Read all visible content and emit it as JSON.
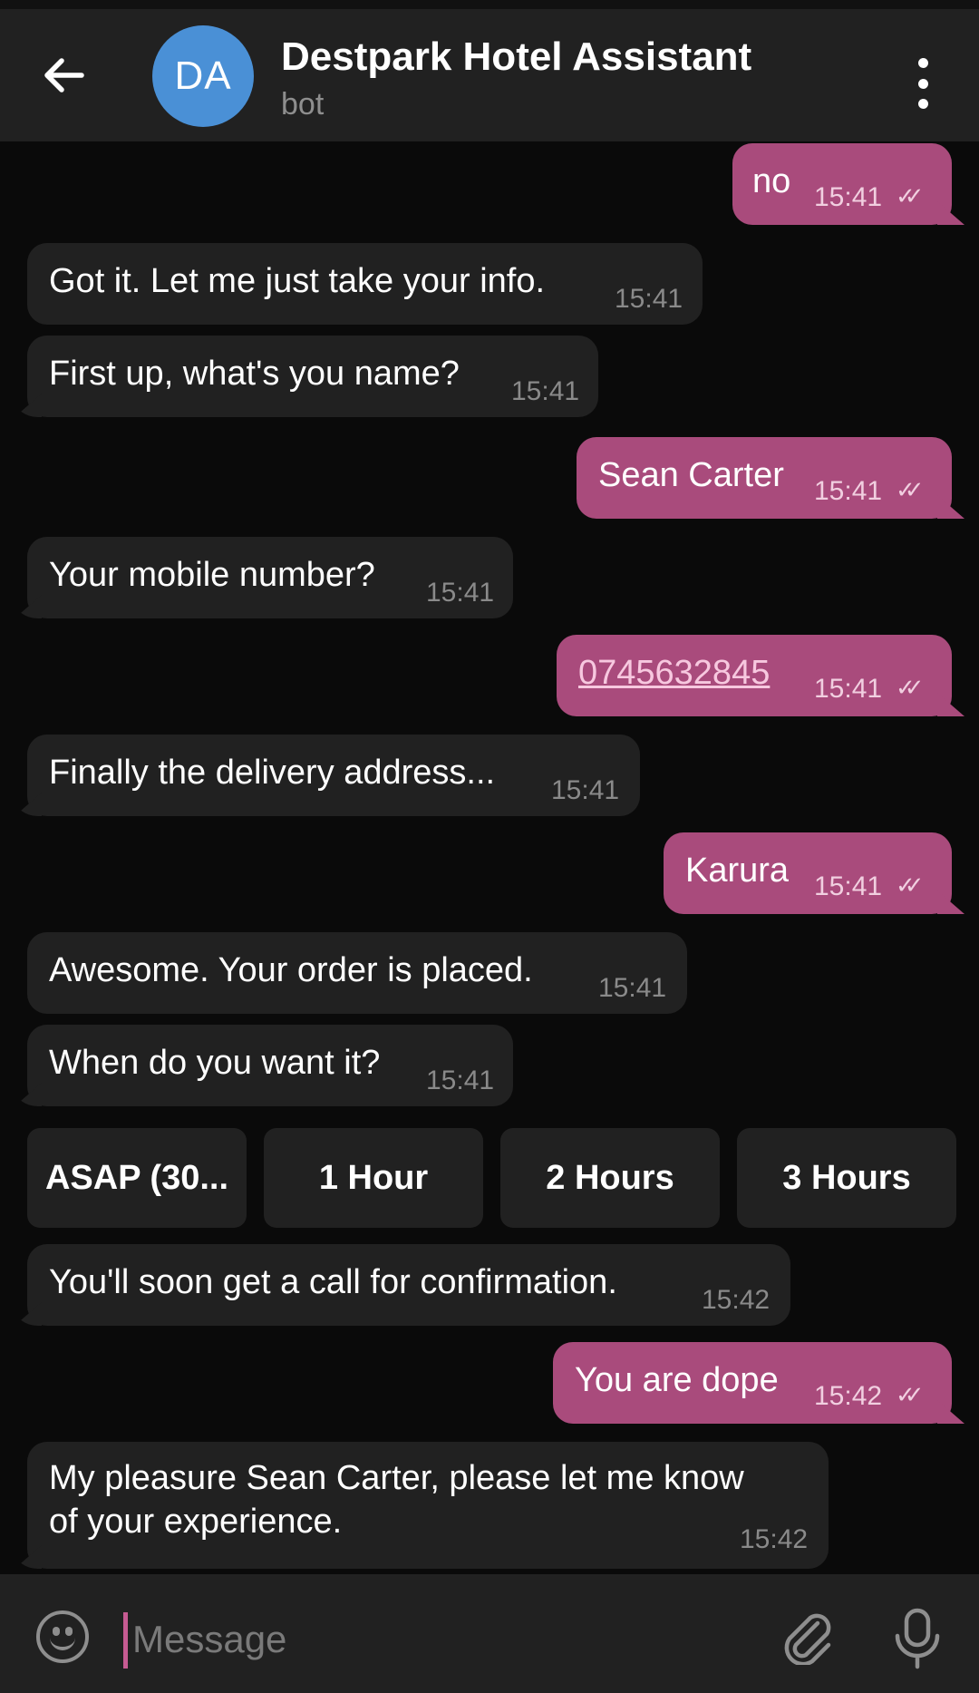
{
  "header": {
    "avatar_initials": "DA",
    "title": "Destpark Hotel Assistant",
    "subtitle": "bot"
  },
  "messages": [
    {
      "from": "me",
      "text": "no",
      "time": "15:41",
      "status": "read"
    },
    {
      "from": "bot",
      "text": "Got it. Let me just take your info.",
      "time": "15:41"
    },
    {
      "from": "bot",
      "text": "First up, what's you name?",
      "time": "15:41"
    },
    {
      "from": "me",
      "text": "Sean Carter",
      "time": "15:41",
      "status": "read"
    },
    {
      "from": "bot",
      "text": "Your mobile number?",
      "time": "15:41"
    },
    {
      "from": "me",
      "text": "0745632845",
      "time": "15:41",
      "status": "read",
      "is_link": true
    },
    {
      "from": "bot",
      "text": "Finally the delivery address...",
      "time": "15:41"
    },
    {
      "from": "me",
      "text": "Karura",
      "time": "15:41",
      "status": "read"
    },
    {
      "from": "bot",
      "text": "Awesome. Your order is placed.",
      "time": "15:41"
    },
    {
      "from": "bot",
      "text": "When do you want it?",
      "time": "15:41"
    },
    {
      "from": "bot",
      "text": "You'll soon get a call for confirmation.",
      "time": "15:42"
    },
    {
      "from": "me",
      "text": "You are dope",
      "time": "15:42",
      "status": "read"
    },
    {
      "from": "bot",
      "text_line1": "My pleasure Sean Carter, please let me know",
      "text_line2": "of your experience.",
      "time": "15:42"
    }
  ],
  "quick_replies": [
    "ASAP (30...",
    "1 Hour",
    "2 Hours",
    "3 Hours"
  ],
  "composer": {
    "placeholder": "Message"
  },
  "colors": {
    "outgoing_bubble": "#a94b7c",
    "incoming_bubble": "#212121",
    "background": "#0a0a0a",
    "header": "#212121",
    "avatar": "#4a90d6"
  },
  "icons": {
    "back": "back-arrow-icon",
    "menu": "more-vertical-icon",
    "emoji": "emoji-icon",
    "attach": "paperclip-icon",
    "mic": "microphone-icon",
    "read": "double-check-icon"
  }
}
